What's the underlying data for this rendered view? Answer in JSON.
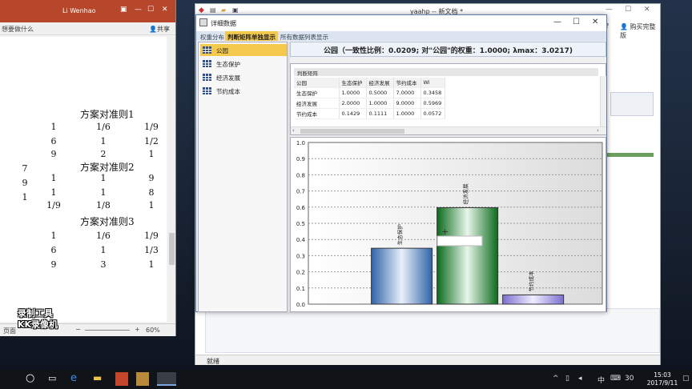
{
  "word": {
    "title": "Li Wenhao",
    "tell_me": "想要做什么",
    "share": "共享",
    "zoom": "60%",
    "status_left": "页面",
    "matrices": [
      {
        "title": "方案对准则1",
        "rows": [
          [
            "1",
            "1/6",
            "1/9"
          ],
          [
            "6",
            "1",
            "1/2"
          ],
          [
            "9",
            "2",
            "1"
          ]
        ]
      },
      {
        "title": "方案对准则2",
        "rows": [
          [
            "1",
            "1",
            "9"
          ],
          [
            "1",
            "1",
            "8"
          ],
          [
            "1/9",
            "1/8",
            "1"
          ]
        ]
      },
      {
        "title": "方案对准则3",
        "rows": [
          [
            "1",
            "1/6",
            "1/9"
          ],
          [
            "6",
            "1",
            "1/3"
          ],
          [
            "9",
            "3",
            "1"
          ]
        ]
      }
    ],
    "left_col": [
      "7",
      "9",
      "1"
    ]
  },
  "watermark": [
    "录制工具",
    "KK录像机"
  ],
  "yaahp": {
    "title": "yaahp -- 新文档 *",
    "help": "?",
    "buy": "购买完整版",
    "status": "就绪"
  },
  "dialog": {
    "title": "详细数据",
    "tabs": [
      "权重分布",
      "判断矩阵单独显示",
      "所有数据列表显示"
    ],
    "active_tab": 1,
    "left_items": [
      "公园",
      "生态保护",
      "经济发展",
      "节约成本"
    ],
    "selected_item": 0,
    "header": "公园（一致性比例：0.0209; 对\"公园\"的权重：1.0000; λmax：3.0217)",
    "matrix_caption": "判断矩阵",
    "matrix_headers": [
      "公园",
      "生态保护",
      "经济发展",
      "节约成本",
      "Wi"
    ],
    "matrix_rows": [
      [
        "生态保护",
        "1.0000",
        "0.5000",
        "7.0000",
        "0.3458"
      ],
      [
        "经济发展",
        "2.0000",
        "1.0000",
        "9.0000",
        "0.5969"
      ],
      [
        "节约成本",
        "0.1429",
        "0.1111",
        "1.0000",
        "0.0572"
      ]
    ]
  },
  "chart_data": {
    "type": "bar",
    "categories": [
      "生态保护",
      "经济发展",
      "节约成本"
    ],
    "values": [
      0.3458,
      0.5969,
      0.0572
    ],
    "ylim": [
      0,
      1.0
    ],
    "yticks": [
      "0.0",
      "0.1",
      "0.2",
      "0.3",
      "0.4",
      "0.5",
      "0.6",
      "0.7",
      "0.8",
      "0.9",
      "1.0"
    ],
    "grid": true,
    "colors": [
      "#5b8fc9",
      "#1f8a2e",
      "#9b8fe0"
    ]
  },
  "taskbar": {
    "time": "15:03",
    "date": "2017/9/11",
    "ime": "中",
    "num": "30"
  }
}
